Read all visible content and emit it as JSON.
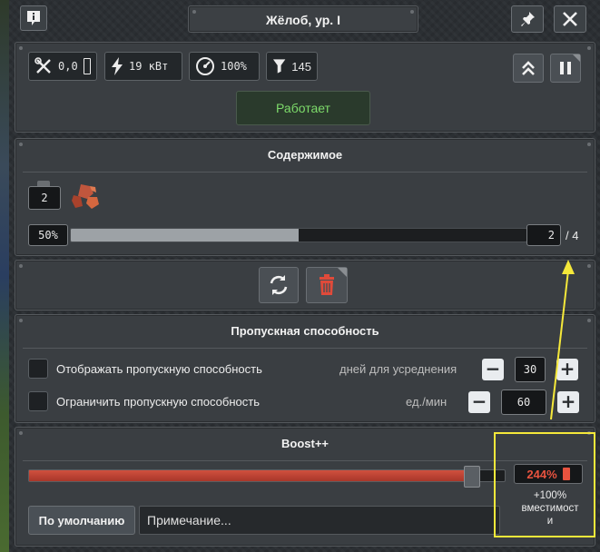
{
  "window": {
    "title": "Жёлоб, ур. I",
    "info_icon": "info-icon",
    "pin_icon": "pin-icon",
    "close_icon": "close-icon"
  },
  "stats": {
    "power_ratio": "0,0",
    "power_draw": "19 кВт",
    "efficiency": "100%",
    "filter_count": "145"
  },
  "status": {
    "label": "Работает",
    "color": "#7ddb6a"
  },
  "contents": {
    "title": "Содержимое",
    "item_count": "2",
    "fill_percent_label": "50%",
    "fill_fraction": 0.5,
    "stack_count": "2",
    "stack_max": "/ 4",
    "item_icon": "copper-ore-icon"
  },
  "actions": {
    "refresh_icon": "refresh-icon",
    "trash_icon": "trash-icon"
  },
  "throughput": {
    "title": "Пропускная способность",
    "show_label": "Отображать пропускную способность",
    "days_label": "дней для усреднения",
    "days_value": "30",
    "limit_label": "Ограничить пропускную способность",
    "unit_label": "ед./мин",
    "limit_value": "60",
    "minus": "−",
    "plus": "+"
  },
  "boost": {
    "title": "Boost++",
    "slider_fraction": 0.93,
    "default_button": "По умолчанию",
    "note_placeholder": "Примечание...",
    "percent": "244%",
    "capacity_line1": "+100%",
    "capacity_line2": "вместимост",
    "capacity_line3": "и"
  },
  "colors": {
    "accent_red": "#c0392b",
    "annotation_yellow": "#f5e83a",
    "status_green": "#7ddb6a"
  }
}
